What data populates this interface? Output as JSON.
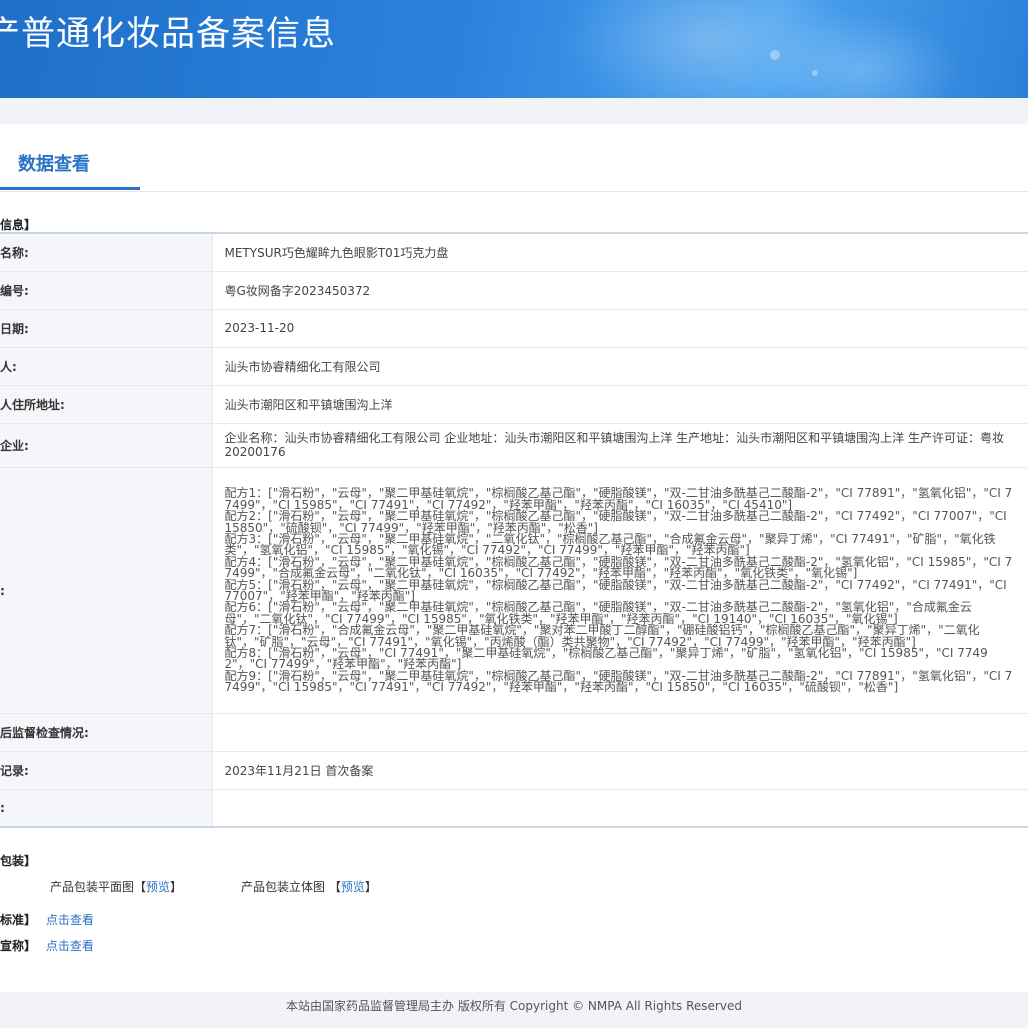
{
  "header": {
    "title": "产普通化妆品备案信息"
  },
  "tab": {
    "label": "数据查看"
  },
  "sections": {
    "product_info": "品信息】",
    "packaging": "品包装】"
  },
  "rows": [
    {
      "label": "品名称:",
      "value": "METYSUR巧色耀眸九色眼影T01巧克力盘"
    },
    {
      "label": "案编号:",
      "value": "粤G妆网备字2023450372"
    },
    {
      "label": "案日期:",
      "value": "2023-11-20"
    },
    {
      "label": "案人:",
      "value": "汕头市协睿精细化工有限公司"
    },
    {
      "label": "案人住所地址:",
      "value": "汕头市潮阳区和平镇塘围沟上洋"
    },
    {
      "label": "产企业:",
      "value": "企业名称：汕头市协睿精细化工有限公司 企业地址：汕头市潮阳区和平镇塘围沟上洋 生产地址：汕头市潮阳区和平镇塘围沟上洋 生产许可证：粤妆20200176"
    },
    {
      "label": "分:",
      "ingredients": [
        "配方1：[\"滑石粉\"，\"云母\"，\"聚二甲基硅氧烷\"，\"棕榈酸乙基己酯\"，\"硬脂酸镁\"，\"双-二甘油多酰基己二酸酯-2\"，\"CI 77891\"，\"氢氧化铝\"，\"CI 77499\"，\"CI 15985\"，\"CI 77491\"，\"CI 77492\"，\"羟苯甲酯\"，\"羟苯丙酯\"，\"CI 16035\"，\"CI 45410\"]",
        "配方2：[\"滑石粉\"，\"云母\"，\"聚二甲基硅氧烷\"，\"棕榈酸乙基己酯\"，\"硬脂酸镁\"，\"双-二甘油多酰基己二酸酯-2\"，\"CI 77492\"，\"CI 77007\"，\"CI 15850\"，\"硫酸钡\"，\"CI 77499\"，\"羟苯甲酯\"，\"羟苯丙酯\"，\"松香\"]",
        "配方3：[\"滑石粉\"，\"云母\"，\"聚二甲基硅氧烷\"，\"二氧化钛\"，\"棕榈酸乙基己酯\"，\"合成氟金云母\"，\"聚异丁烯\"，\"CI 77491\"，\"矿脂\"，\"氧化铁类\"，\"氢氧化铝\"，\"CI 15985\"，\"氧化锡\"，\"CI 77492\"，\"CI 77499\"，\"羟苯甲酯\"，\"羟苯丙酯\"]",
        "配方4：[\"滑石粉\"，\"云母\"，\"聚二甲基硅氧烷\"，\"棕榈酸乙基己酯\"，\"硬脂酸镁\"，\"双-二甘油多酰基己二酸酯-2\"，\"氢氧化铝\"，\"CI 15985\"，\"CI 77499\"，\"合成氟金云母\"，\"二氧化钛\"，\"CI 16035\"，\"CI 77492\"，\"羟苯甲酯\"，\"羟苯丙酯\"，\"氧化铁类\"，\"氧化锡\"]",
        "配方5：[\"滑石粉\"，\"云母\"，\"聚二甲基硅氧烷\"，\"棕榈酸乙基己酯\"，\"硬脂酸镁\"，\"双-二甘油多酰基己二酸酯-2\"，\"CI 77492\"，\"CI 77491\"，\"CI 77007\"，\"羟苯甲酯\"，\"羟苯丙酯\"]",
        "配方6：[\"滑石粉\"，\"云母\"，\"聚二甲基硅氧烷\"，\"棕榈酸乙基己酯\"，\"硬脂酸镁\"，\"双-二甘油多酰基己二酸酯-2\"，\"氢氧化铝\"，\"合成氟金云母\"，\"二氧化钛\"，\"CI 77499\"，\"CI 15985\"，\"氧化铁类\"，\"羟苯甲酯\"，\"羟苯丙酯\"，\"CI 19140\"，\"CI 16035\"，\"氧化锡\"]",
        "配方7：[\"滑石粉\"，\"合成氟金云母\"，\"聚二甲基硅氧烷\"，\"聚对苯二甲酸丁二醇酯\"，\"硼硅酸铝钙\"，\"棕榈酸乙基己酯\"，\"聚异丁烯\"，\"二氧化钛\"，\"矿脂\"，\"云母\"，\"CI 77491\"，\"氧化锡\"，\"丙烯酸（酯）类共聚物\"，\"CI 77492\"，\"CI 77499\"，\"羟苯甲酯\"，\"羟苯丙酯\"]",
        "配方8：[\"滑石粉\"，\"云母\"，\"CI 77491\"，\"聚二甲基硅氧烷\"，\"棕榈酸乙基己酯\"，\"聚异丁烯\"，\"矿脂\"，\"氢氧化铝\"，\"CI 15985\"，\"CI 77492\"，\"CI 77499\"，\"羟苯甲酯\"，\"羟苯丙酯\"]",
        "配方9：[\"滑石粉\"，\"云母\"，\"聚二甲基硅氧烷\"，\"棕榈酸乙基己酯\"，\"硬脂酸镁\"，\"双-二甘油多酰基己二酸酯-2\"，\"CI 77891\"，\"氢氧化铝\"，\"CI 77499\"，\"CI 15985\"，\"CI 77491\"，\"CI 77492\"，\"羟苯甲酯\"，\"羟苯丙酯\"，\"CI 15850\"，\"CI 16035\"，\"硫酸钡\"，\"松香\"]"
      ]
    },
    {
      "label": "案后监督检查情况:",
      "value": ""
    },
    {
      "label": "史记录:",
      "value": "2023年11月21日 首次备案"
    },
    {
      "label": "注:",
      "value": ""
    }
  ],
  "packaging": {
    "flat_label": "产品包装平面图",
    "flat_link": "预览",
    "three_d_label": "产品包装立体图",
    "three_d_link": "预览",
    "bracket_open": "【",
    "bracket_close": "】"
  },
  "standard": {
    "label": "行标准】",
    "link": "点击查看"
  },
  "efficacy": {
    "label": "效宣称】",
    "link": "点击查看"
  },
  "footer": {
    "text": "本站由国家药品监督管理局主办 版权所有 Copyright © NMPA All Rights Reserved"
  },
  "colors": {
    "banner": "#2b82de",
    "accent": "#2a73c5"
  }
}
